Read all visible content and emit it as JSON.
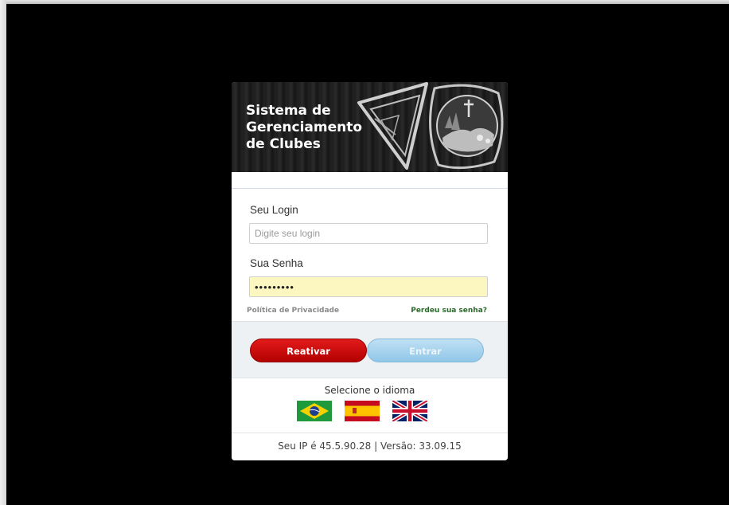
{
  "header": {
    "title_lines": [
      "Sistema de",
      "Gerenciamento",
      "de Clubes"
    ]
  },
  "form": {
    "login_label": "Seu Login",
    "login_placeholder": "Digite seu login",
    "login_value": "",
    "password_label": "Sua Senha",
    "password_value": "•••••••••",
    "privacy_link": "Política de Privacidade",
    "forgot_link": "Perdeu sua senha?"
  },
  "buttons": {
    "reactivate_label": "Reativar",
    "enter_label": "Entrar"
  },
  "language": {
    "label": "Selecione o idioma",
    "flags": [
      "brazil-flag-icon",
      "spain-flag-icon",
      "uk-flag-icon"
    ]
  },
  "footer": {
    "info": "Seu IP é 45.5.90.28 | Versão: 33.09.15"
  },
  "colors": {
    "reactivate": "#d40000",
    "enter": "#a9d4ef",
    "forgot_link": "#2a6a2a",
    "password_bg": "#fcf6c0"
  }
}
